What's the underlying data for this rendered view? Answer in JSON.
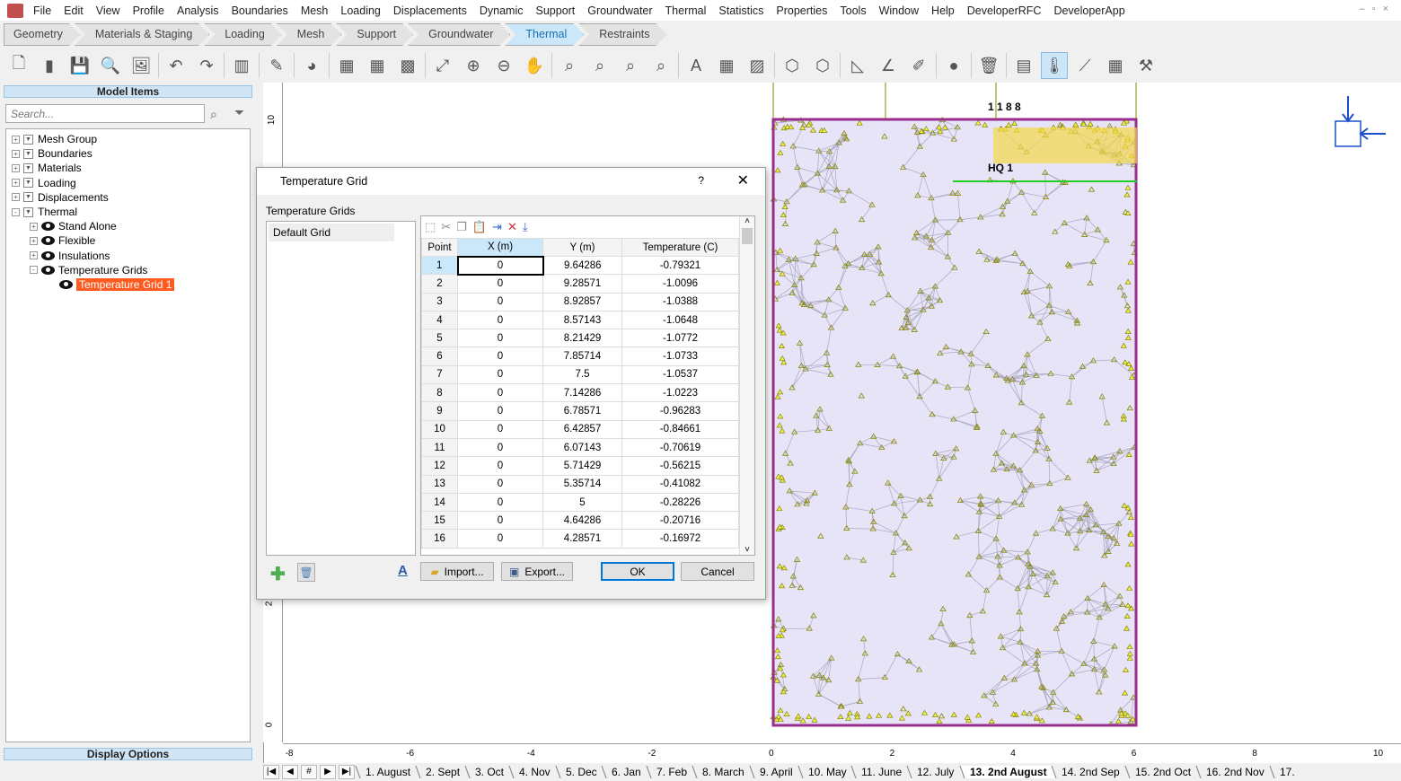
{
  "menu": [
    "File",
    "Edit",
    "View",
    "Profile",
    "Analysis",
    "Boundaries",
    "Mesh",
    "Loading",
    "Displacements",
    "Dynamic",
    "Support",
    "Groundwater",
    "Thermal",
    "Statistics",
    "Properties",
    "Tools",
    "Window",
    "Help",
    "DeveloperRFC",
    "DeveloperApp"
  ],
  "workflow": [
    {
      "label": "Geometry"
    },
    {
      "label": "Materials & Staging"
    },
    {
      "label": "Loading"
    },
    {
      "label": "Mesh"
    },
    {
      "label": "Support"
    },
    {
      "label": "Groundwater"
    },
    {
      "label": "Thermal",
      "active": true
    },
    {
      "label": "Restraints"
    }
  ],
  "left_panel": {
    "title": "Model Items",
    "search_placeholder": "Search...",
    "footer": "Display Options",
    "tree": [
      {
        "label": "Mesh Group",
        "level": 0,
        "exp": "+"
      },
      {
        "label": "Boundaries",
        "level": 0,
        "exp": "+"
      },
      {
        "label": "Materials",
        "level": 0,
        "exp": "+"
      },
      {
        "label": "Loading",
        "level": 0,
        "exp": "+"
      },
      {
        "label": "Displacements",
        "level": 0,
        "exp": "+"
      },
      {
        "label": "Thermal",
        "level": 0,
        "exp": "-"
      },
      {
        "label": "Stand Alone",
        "level": 1,
        "exp": "+",
        "eye": true
      },
      {
        "label": "Flexible",
        "level": 1,
        "exp": "+",
        "eye": true
      },
      {
        "label": "Insulations",
        "level": 1,
        "exp": "+",
        "eye": true
      },
      {
        "label": "Temperature Grids",
        "level": 1,
        "exp": "-",
        "eye": true
      },
      {
        "label": "Temperature Grid 1",
        "level": 2,
        "eye": true,
        "selected": true
      }
    ]
  },
  "dialog": {
    "title": "Temperature Grid",
    "help": "?",
    "close": "✕",
    "section": "Temperature Grids",
    "grids": [
      "Default Grid"
    ],
    "columns": [
      "Point",
      "X (m)",
      "Y (m)",
      "Temperature (C)"
    ],
    "rows": [
      [
        "1",
        "0",
        "9.64286",
        "-0.79321"
      ],
      [
        "2",
        "0",
        "9.28571",
        "-1.0096"
      ],
      [
        "3",
        "0",
        "8.92857",
        "-1.0388"
      ],
      [
        "4",
        "0",
        "8.57143",
        "-1.0648"
      ],
      [
        "5",
        "0",
        "8.21429",
        "-1.0772"
      ],
      [
        "6",
        "0",
        "7.85714",
        "-1.0733"
      ],
      [
        "7",
        "0",
        "7.5",
        "-1.0537"
      ],
      [
        "8",
        "0",
        "7.14286",
        "-1.0223"
      ],
      [
        "9",
        "0",
        "6.78571",
        "-0.96283"
      ],
      [
        "10",
        "0",
        "6.42857",
        "-0.84661"
      ],
      [
        "11",
        "0",
        "6.07143",
        "-0.70619"
      ],
      [
        "12",
        "0",
        "5.71429",
        "-0.56215"
      ],
      [
        "13",
        "0",
        "5.35714",
        "-0.41082"
      ],
      [
        "14",
        "0",
        "5",
        "-0.28226"
      ],
      [
        "15",
        "0",
        "4.64286",
        "-0.20716"
      ],
      [
        "16",
        "0",
        "4.28571",
        "-0.16972"
      ]
    ],
    "import": "Import...",
    "export": "Export...",
    "ok": "OK",
    "cancel": "Cancel"
  },
  "canvas": {
    "x_ticks": [
      "-8",
      "-6",
      "-4",
      "-2",
      "0",
      "2",
      "4",
      "6",
      "8",
      "10"
    ],
    "y_ticks": [
      "0",
      "2",
      "10"
    ],
    "mesh_labels": [
      "1 1 8 8",
      "HQ 1"
    ],
    "mesh_fill": "#e6e4f6",
    "boundary_color": "#9b2d8f",
    "node_color": "#e6e600"
  },
  "stages": [
    "1. August",
    "2. Sept",
    "3. Oct",
    "4. Nov",
    "5. Dec",
    "6. Jan",
    "7. Feb",
    "8. March",
    "9. April",
    "10. May",
    "11. June",
    "12. July",
    "13. 2nd August",
    "14. 2nd Sep",
    "15. 2nd Oct",
    "16. 2nd Nov",
    "17."
  ],
  "current_stage": "13. 2nd August",
  "stage_nav": [
    "|◀",
    "◀",
    "#",
    "▶",
    "▶|"
  ]
}
